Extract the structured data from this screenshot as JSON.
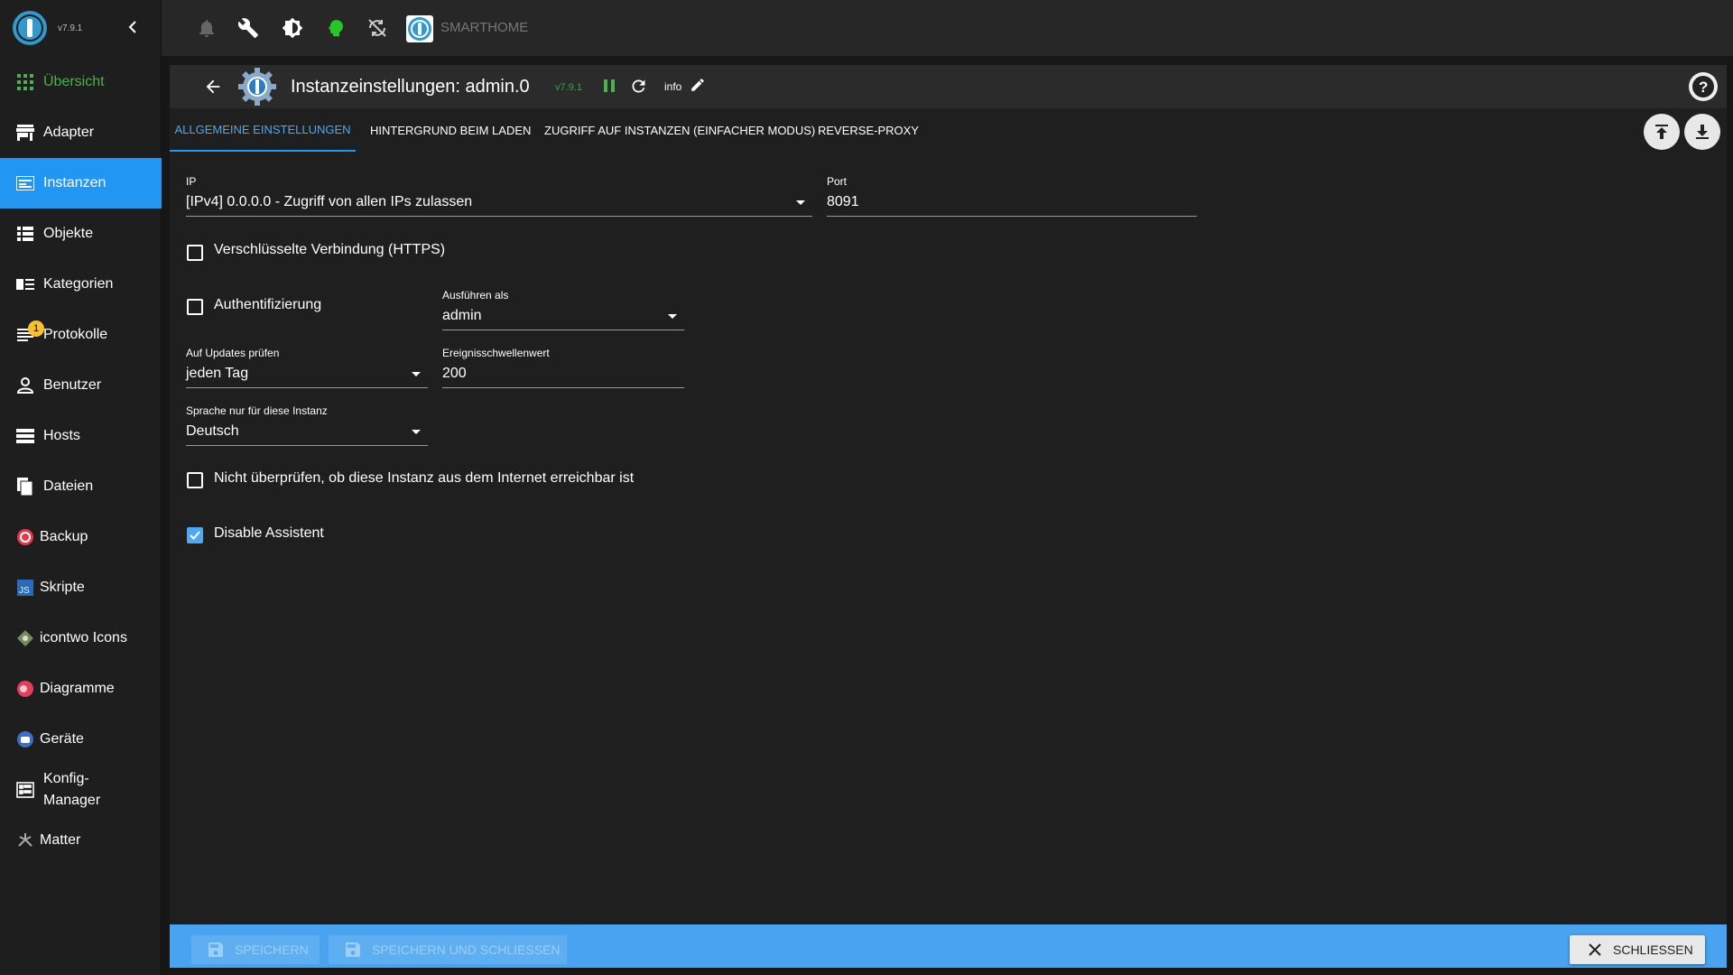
{
  "app": {
    "version": "v7.9.1",
    "title": "SMARTHOME"
  },
  "sidebar": {
    "items": [
      {
        "label": "Übersicht",
        "icon": "grid-icon"
      },
      {
        "label": "Adapter",
        "icon": "store-icon"
      },
      {
        "label": "Instanzen",
        "icon": "instances-icon"
      },
      {
        "label": "Objekte",
        "icon": "list-icon"
      },
      {
        "label": "Kategorien",
        "icon": "categories-icon"
      },
      {
        "label": "Protokolle",
        "icon": "log-icon",
        "badge": "1"
      },
      {
        "label": "Benutzer",
        "icon": "user-icon"
      },
      {
        "label": "Hosts",
        "icon": "hosts-icon"
      },
      {
        "label": "Dateien",
        "icon": "files-icon"
      },
      {
        "label": "Backup",
        "icon": "backup-icon"
      },
      {
        "label": "Skripte",
        "icon": "js-icon"
      },
      {
        "label": "icontwo Icons",
        "icon": "icontwo-icon"
      },
      {
        "label": "Diagramme",
        "icon": "chart-icon"
      },
      {
        "label": "Geräte",
        "icon": "devices-icon"
      },
      {
        "label": "Konfig-Manager",
        "icon": "config-icon"
      },
      {
        "label": "Matter",
        "icon": "matter-icon"
      }
    ]
  },
  "header": {
    "title": "Instanzeinstellungen: admin.0",
    "version": "v7.9.1",
    "info": "info"
  },
  "tabs": [
    "ALLGEMEINE EINSTELLUNGEN",
    "HINTERGRUND BEIM LADEN",
    "ZUGRIFF AUF INSTANZEN (EINFACHER MODUS)",
    "REVERSE-PROXY"
  ],
  "form": {
    "ip": {
      "label": "IP",
      "value": "[IPv4] 0.0.0.0 - Zugriff von allen IPs zulassen"
    },
    "port": {
      "label": "Port",
      "value": "8091"
    },
    "https": {
      "label": "Verschlüsselte Verbindung (HTTPS)",
      "checked": false
    },
    "auth": {
      "label": "Authentifizierung",
      "checked": false
    },
    "run_as": {
      "label": "Ausführen als",
      "value": "admin"
    },
    "updates": {
      "label": "Auf Updates prüfen",
      "value": "jeden Tag"
    },
    "threshold": {
      "label": "Ereignisschwellenwert",
      "value": "200"
    },
    "language": {
      "label": "Sprache nur für diese Instanz",
      "value": "Deutsch"
    },
    "no_check": {
      "label": "Nicht überprüfen, ob diese Instanz aus dem Internet erreichbar ist",
      "checked": false
    },
    "disable_assistant": {
      "label": "Disable Assistent",
      "checked": true
    }
  },
  "footer": {
    "save": "SPEICHERN",
    "save_close": "SPEICHERN UND SCHLIESSEN",
    "close": "SCHLIESSEN"
  },
  "colors": {
    "accent": "#2196f3",
    "green": "#4caf50",
    "footer": "#4aa3f0"
  }
}
